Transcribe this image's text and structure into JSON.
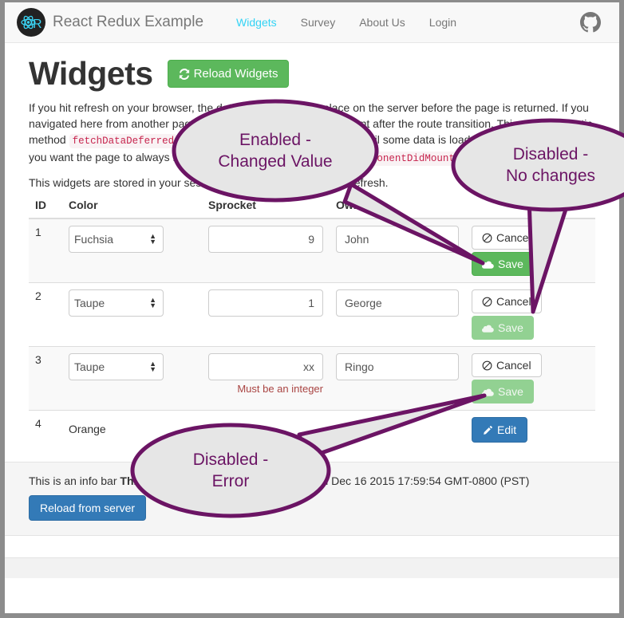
{
  "navbar": {
    "brand_logo_icon": "react-logo-icon",
    "brand_name": "React Redux Example",
    "links": [
      {
        "label": "Widgets",
        "active": true
      },
      {
        "label": "Survey",
        "active": false
      },
      {
        "label": "About Us",
        "active": false
      },
      {
        "label": "Login",
        "active": false
      }
    ],
    "github_icon": "github-icon",
    "active_color": "#33d3f5",
    "text_color": "#777777"
  },
  "page": {
    "title": "Widgets",
    "reload_button": {
      "label": "Reload Widgets",
      "icon": "refresh-icon"
    },
    "paragraph1_part1": "If you hit refresh on your browser, the data loading will take place on the server before the page is returned. If you navigated here from another page, the data was fetched on the client after the route transition. This uses the static method ",
    "paragraph1_code1": "fetchDataDeferred",
    "paragraph1_part2": " to fetch the data. If you want to wait until some data is loaded, use ",
    "paragraph1_code2": "fetchData",
    "paragraph1_part3": ". If you want the page to always render before loading the data, use ",
    "paragraph1_code3": "componentDidMount",
    "paragraph1_part4": ".",
    "paragraph2": "This widgets are stored in your session, so feel free to edit it and refresh."
  },
  "table": {
    "columns": [
      "ID",
      "Color",
      "Sprocket",
      "Owner",
      ""
    ],
    "rows": [
      {
        "id": "1",
        "editing": true,
        "color": "Fuchsia",
        "sprocket": "9",
        "owner": "John",
        "error": "",
        "cancel_label": "Cancel",
        "cancel_icon": "ban-icon",
        "save_label": "Save",
        "save_icon": "cloud-icon",
        "save_disabled": false
      },
      {
        "id": "2",
        "editing": true,
        "color": "Taupe",
        "sprocket": "1",
        "owner": "George",
        "error": "",
        "cancel_label": "Cancel",
        "cancel_icon": "ban-icon",
        "save_label": "Save",
        "save_icon": "cloud-icon",
        "save_disabled": true
      },
      {
        "id": "3",
        "editing": true,
        "color": "Taupe",
        "sprocket": "xx",
        "owner": "Ringo",
        "error": "Must be an integer",
        "cancel_label": "Cancel",
        "cancel_icon": "ban-icon",
        "save_label": "Save",
        "save_icon": "cloud-icon",
        "save_disabled": true
      },
      {
        "id": "4",
        "editing": false,
        "color": "Orange",
        "sprocket": "",
        "owner": "Paul",
        "error": "",
        "edit_label": "Edit",
        "edit_icon": "pencil-icon"
      }
    ],
    "color_options": [
      "Fuchsia",
      "Taupe",
      "Orange"
    ]
  },
  "infobar": {
    "text_plain": "This is an info bar ",
    "text_bold": "This came from the api server",
    "date": "Wed Dec 16 2015 17:59:54 GMT-0800 (PST)",
    "reload_button": "Reload from server"
  },
  "callouts": [
    {
      "text": "Enabled -\nChanged Value"
    },
    {
      "text": "Disabled -\nNo changes"
    },
    {
      "text": "Disabled -\nError"
    }
  ],
  "colors": {
    "callout_stroke": "#6b1464",
    "callout_fill": "#e6e6e6",
    "success": "#5cb85c",
    "success_disabled": "#92d192",
    "primary": "#337ab7",
    "error": "#a94442",
    "code": "#c7254e"
  }
}
